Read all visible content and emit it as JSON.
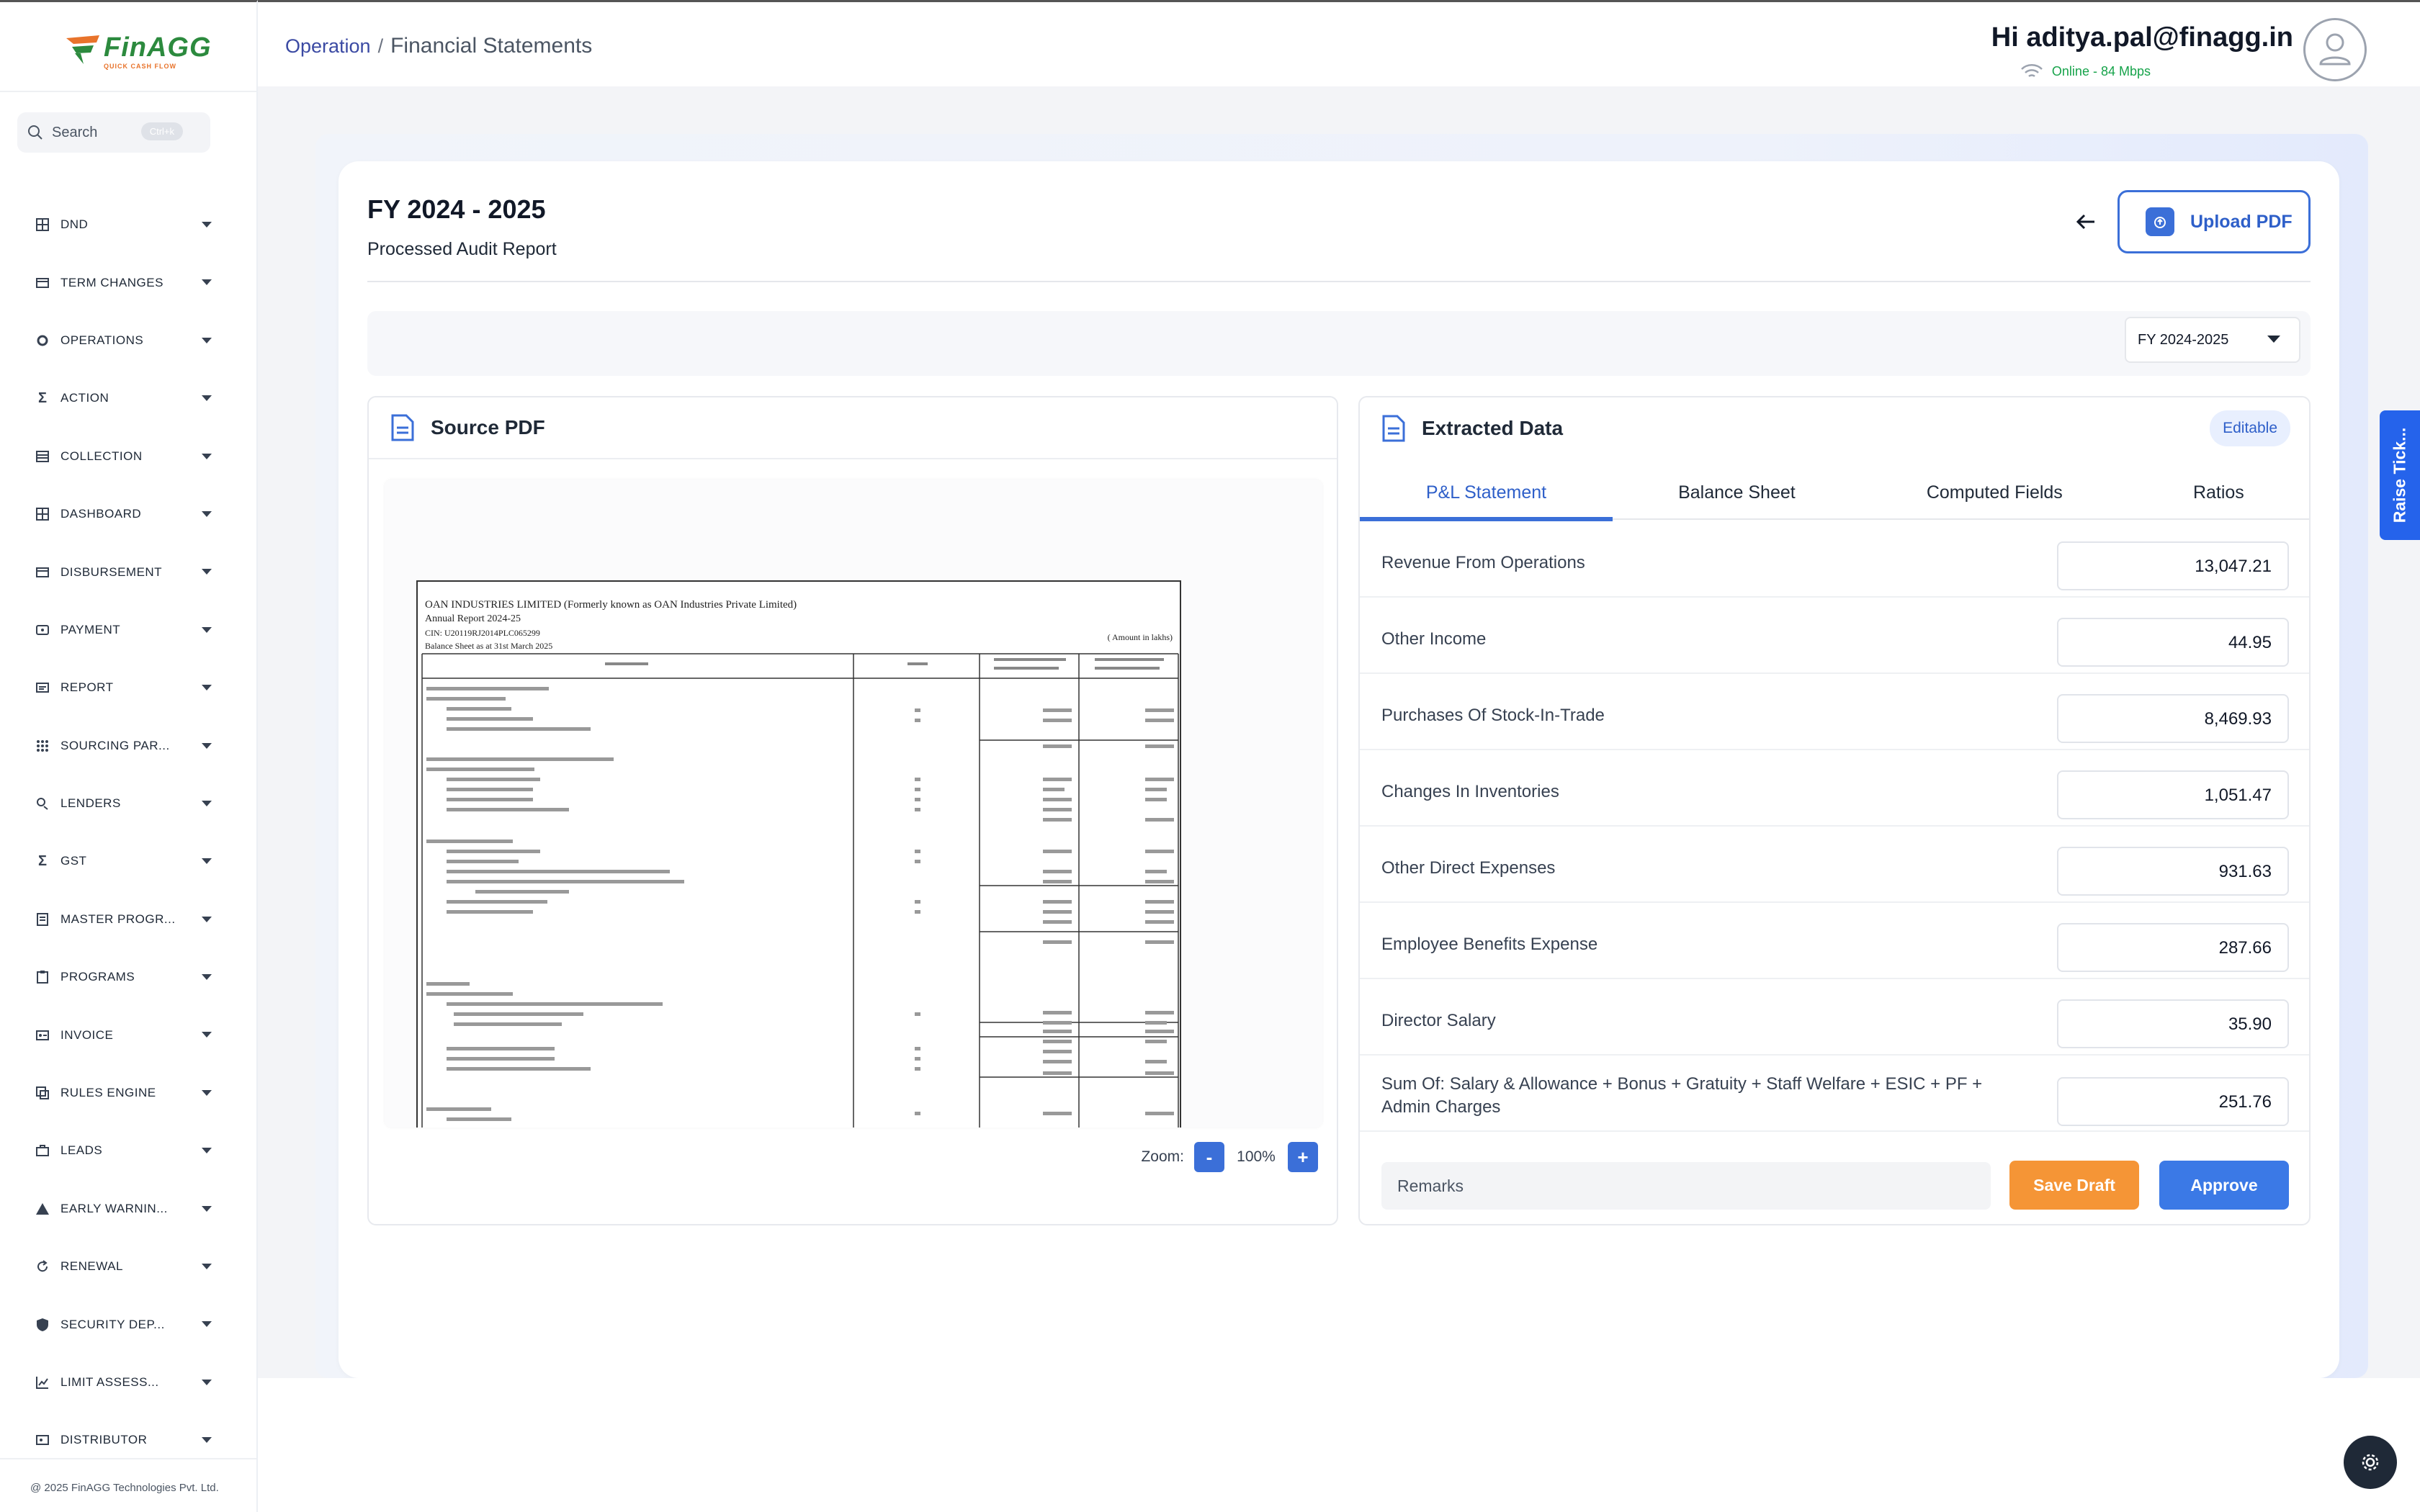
{
  "brand": {
    "logo_text": "FinAGG",
    "tagline": "QUICK CASH FLOW"
  },
  "sidebar": {
    "search_placeholder": "Search",
    "search_shortcut": "Ctrl+k",
    "items": [
      {
        "label": "DND",
        "icon": "grid-icon"
      },
      {
        "label": "TERM CHANGES",
        "icon": "card-icon"
      },
      {
        "label": "OPERATIONS",
        "icon": "gear-icon"
      },
      {
        "label": "ACTION",
        "icon": "sigma-icon"
      },
      {
        "label": "COLLECTION",
        "icon": "stack-icon"
      },
      {
        "label": "DASHBOARD",
        "icon": "grid-icon"
      },
      {
        "label": "DISBURSEMENT",
        "icon": "card-icon"
      },
      {
        "label": "PAYMENT",
        "icon": "payment-icon"
      },
      {
        "label": "REPORT",
        "icon": "report-icon"
      },
      {
        "label": "SOURCING PAR...",
        "icon": "dots-grid-icon"
      },
      {
        "label": "LENDERS",
        "icon": "lenders-icon"
      },
      {
        "label": "GST",
        "icon": "sigma-icon"
      },
      {
        "label": "MASTER PROGR...",
        "icon": "document-icon"
      },
      {
        "label": "PROGRAMS",
        "icon": "clipboard-icon"
      },
      {
        "label": "INVOICE",
        "icon": "invoice-icon"
      },
      {
        "label": "RULES ENGINE",
        "icon": "rules-icon"
      },
      {
        "label": "LEADS",
        "icon": "leads-icon"
      },
      {
        "label": "EARLY WARNIN...",
        "icon": "warning-icon"
      },
      {
        "label": "RENEWAL",
        "icon": "refresh-icon"
      },
      {
        "label": "SECURITY DEP...",
        "icon": "shield-icon"
      },
      {
        "label": "LIMIT ASSESS...",
        "icon": "chart-icon"
      },
      {
        "label": "DISTRIBUTOR",
        "icon": "distributor-icon"
      }
    ],
    "footer": "@ 2025 FinAGG Technologies Pvt. Ltd."
  },
  "header": {
    "breadcrumb_parent": "Operation",
    "breadcrumb_separator": "/",
    "breadcrumb_current": "Financial Statements",
    "greeting": "Hi aditya.pal@finagg.in",
    "status": "Online - 84 Mbps"
  },
  "page": {
    "title": "FY 2024 - 2025",
    "subtitle": "Processed Audit Report",
    "upload_label": "Upload PDF",
    "fy_select_value": "FY 2024-2025"
  },
  "source_pdf": {
    "title": "Source PDF",
    "doc_company": "OAN INDUSTRIES LIMITED (Formerly known as OAN Industries Private Limited)",
    "doc_report": "Annual Report 2024-25",
    "doc_cin": "CIN: U20119RJ2014PLC065299",
    "doc_sheet": "Balance Sheet as at 31st March 2025",
    "doc_amount_note": "( Amount in lakhs)",
    "zoom_label": "Zoom:",
    "zoom_minus": "-",
    "zoom_value": "100%",
    "zoom_plus": "+"
  },
  "extracted": {
    "title": "Extracted Data",
    "badge": "Editable",
    "tabs": [
      "P&L Statement",
      "Balance Sheet",
      "Computed Fields",
      "Ratios"
    ],
    "active_tab": "P&L Statement",
    "rows": [
      {
        "label": "Revenue From Operations",
        "value": "13,047.21"
      },
      {
        "label": "Other Income",
        "value": "44.95"
      },
      {
        "label": "Purchases Of Stock-In-Trade",
        "value": "8,469.93"
      },
      {
        "label": "Changes In Inventories",
        "value": "1,051.47"
      },
      {
        "label": "Other Direct Expenses",
        "value": "931.63"
      },
      {
        "label": "Employee Benefits Expense",
        "value": "287.66"
      },
      {
        "label": "Director Salary",
        "value": "35.90"
      },
      {
        "label": "Sum Of: Salary & Allowance + Bonus + Gratuity + Staff Welfare + ESIC + PF + Admin Charges",
        "value": "251.76"
      }
    ],
    "remarks_placeholder": "Remarks",
    "save_draft": "Save Draft",
    "approve": "Approve"
  },
  "raise_ticket": "Raise Tick...",
  "colors": {
    "primary": "#3b6fd8",
    "accent_orange": "#f59536",
    "online_green": "#16a34a",
    "brand_green": "#2c8a3e"
  }
}
